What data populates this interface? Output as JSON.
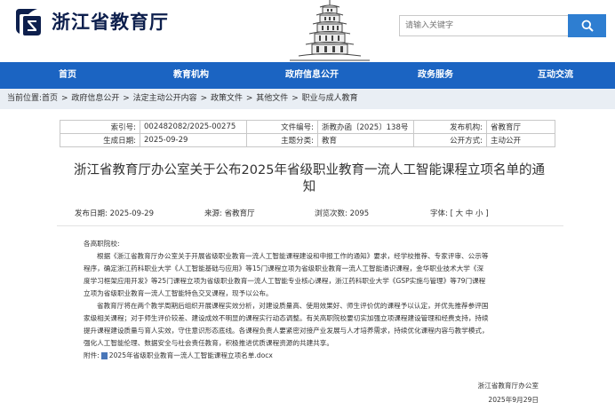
{
  "header": {
    "site_title": "浙江省教育厅",
    "search_placeholder": "请输入关键字"
  },
  "nav": {
    "items": [
      "首页",
      "教育机构",
      "政府信息公开",
      "政务服务",
      "互动交流"
    ]
  },
  "breadcrumb": {
    "prefix": "当前位置:",
    "items": [
      "首页",
      "政府信息公开",
      "法定主动公开内容",
      "政策文件",
      "其他文件",
      "职业与成人教育"
    ],
    "separator": ">"
  },
  "meta": {
    "index_label": "索引号:",
    "index_value": "002482082/2025-00275",
    "doc_no_label": "文件编号:",
    "doc_no_value": "浙教办函〔2025〕138号",
    "issuer_label": "发布机构:",
    "issuer_value": "省教育厅",
    "date_label": "生成日期:",
    "date_value": "2025-09-29",
    "category_label": "主题分类:",
    "category_value": "教育",
    "publicity_label": "公开方式:",
    "publicity_value": "主动公开"
  },
  "title_line1": "浙江省教育厅办公室关于公布2025年省级职业教育一流人工智能课程立项名单的通",
  "title_line2": "知",
  "info": {
    "publish_date_label": "发布日期:",
    "publish_date": "2025-09-29",
    "source_label": "来源:",
    "source": "省教育厅",
    "views_label": "浏览次数:",
    "views": "2095",
    "font_label": "字体:",
    "font_options": "[ 大 中 小 ]"
  },
  "body": {
    "greeting": "各高职院校:",
    "para1_l1": "根据《浙江省教育厅办公室关于开展省级职业教育一流人工智能课程建设和申报工作的通知》要求，经学校推荐、专家评审、公示等",
    "para1_l2": "程序，确定浙江药科职业大学《人工智能基础与应用》等15门课程立项为省级职业教育一流人工智能通识课程，金华职业技术大学《深",
    "para1_l3": "度学习框架应用开发》等25门课程立项为省级职业教育一流人工智能专业核心课程，浙江药科职业大学《GSP实施与管理》等79门课程",
    "para1_l4": "立项为省级职业教育一流人工智能特色交叉课程，现予以公布。",
    "para2_l1": "省教育厅将在两个教学周期后组织开展课程实效分析，对建设质量高、使用效果好、师生评价优的课程予以认定，并优先推荐参评国",
    "para2_l2": "家级相关课程；对于师生评价较差、建设成效不明显的课程实行动态调整。有关高职院校要切实加强立项课程建设管理和经费支持，持续",
    "para2_l3": "提升课程建设质量与育人实效，守住意识形态底线。各课程负责人要紧密对接产业发展与人才培养需求，持续优化课程内容与教学模式，",
    "para2_l4": "强化人工智能伦理、数据安全与社会责任教育，积极推进优质课程资源的共建共享。",
    "attachment_label": "附件:",
    "attachment_name": "2025年省级职业教育一流人工智能课程立项名单.docx",
    "signature": "浙江省教育厅办公室",
    "sign_date": "2025年9月29日"
  },
  "colors": {
    "nav_bg": "#1b64c2",
    "search_btn": "#2e7ed1",
    "breadcrumb_bg": "#e9eef4",
    "title_text": "#0d1f4d"
  },
  "icons": [
    "logo-icon",
    "pagoda-icon",
    "search-icon",
    "attachment-icon"
  ]
}
